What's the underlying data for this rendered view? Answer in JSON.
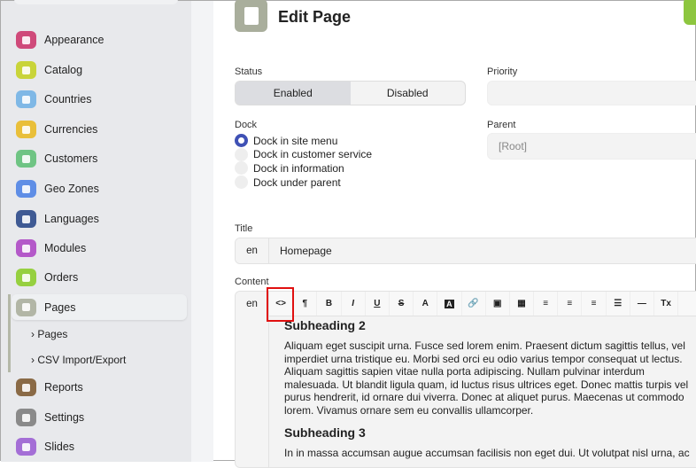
{
  "sidebar": {
    "items": [
      {
        "label": "Appearance",
        "icon": "appearance-icon",
        "color": "#cf4a7a"
      },
      {
        "label": "Catalog",
        "icon": "catalog-icon",
        "color": "#c9d43a"
      },
      {
        "label": "Countries",
        "icon": "flag-icon",
        "color": "#7fb8e6"
      },
      {
        "label": "Currencies",
        "icon": "money-icon",
        "color": "#e9bf3a"
      },
      {
        "label": "Customers",
        "icon": "user-icon",
        "color": "#6fc484"
      },
      {
        "label": "Geo Zones",
        "icon": "globe-icon",
        "color": "#5f8ee6"
      },
      {
        "label": "Languages",
        "icon": "comments-icon",
        "color": "#3f5a94"
      },
      {
        "label": "Modules",
        "icon": "cube-icon",
        "color": "#b459c9"
      },
      {
        "label": "Orders",
        "icon": "cart-icon",
        "color": "#96d040"
      },
      {
        "label": "Pages",
        "icon": "file-icon",
        "color": "#b2b6a6"
      },
      {
        "label": "Reports",
        "icon": "pie-chart-icon",
        "color": "#8a6a46"
      },
      {
        "label": "Settings",
        "icon": "cogs-icon",
        "color": "#8a8a8a"
      },
      {
        "label": "Slides",
        "icon": "image-icon",
        "color": "#a46ed6"
      }
    ],
    "subitems": [
      "Pages",
      "CSV Import/Export"
    ]
  },
  "header": {
    "title": "Edit Page"
  },
  "form": {
    "status_label": "Status",
    "status_options": [
      "Enabled",
      "Disabled"
    ],
    "status_selected": "Enabled",
    "priority_label": "Priority",
    "priority_value": "",
    "dock_label": "Dock",
    "dock_options": [
      "Dock in site menu",
      "Dock in customer service",
      "Dock in information",
      "Dock under parent"
    ],
    "dock_selected": "Dock in site menu",
    "parent_label": "Parent",
    "parent_value": "[Root]",
    "title_label": "Title",
    "title_lang": "en",
    "title_value": "Homepage",
    "content_label": "Content",
    "content_lang": "en"
  },
  "editor": {
    "toolbar": [
      "<>",
      "¶",
      "B",
      "I",
      "U",
      "S",
      "A",
      "A",
      "🔗",
      "▣",
      "▦",
      "≡",
      "≡",
      "≡",
      "☰",
      "—",
      "Tx"
    ],
    "toolbar_names": [
      "source-code",
      "paragraph",
      "bold",
      "italic",
      "underline",
      "strikethrough",
      "font-color",
      "background-color",
      "link",
      "image",
      "table",
      "align-left",
      "align-center",
      "align-right",
      "bullet-list",
      "horizontal-rule",
      "clear-format"
    ],
    "blocks": [
      {
        "heading": "Subheading 2",
        "text": "Aliquam eget suscipit urna. Fusce sed lorem enim. Praesent dictum sagittis tellus, vel imperdiet urna tristique eu. Morbi sed orci eu odio varius tempor consequat ut lectus. Aliquam sagittis sapien vitae nulla porta adipiscing. Nullam pulvinar interdum malesuada. Ut blandit ligula quam, id luctus risus ultrices eget. Donec mattis turpis vel purus hendrerit, id ornare dui viverra. Donec at aliquet purus. Maecenas ut commodo lorem. Vivamus ornare sem eu convallis ullamcorper."
      },
      {
        "heading": "Subheading 3",
        "text": "In in massa accumsan augue accumsan facilisis non eget dui. Ut volutpat nisl urna, ac"
      }
    ]
  },
  "highlight": {
    "color": "#e01010",
    "target": "source-code"
  }
}
